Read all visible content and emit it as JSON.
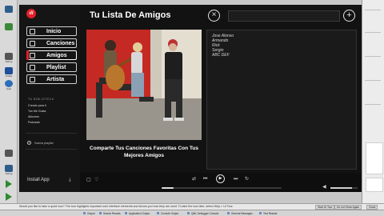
{
  "app": {
    "logo_text": "ıll",
    "nav": [
      {
        "label": "Inicio",
        "icon": "home-icon"
      },
      {
        "label": "Canciones",
        "icon": "music-note-icon"
      },
      {
        "label": "Amigos",
        "icon": "friends-icon"
      },
      {
        "label": "Playlist",
        "icon": "playlist-icon"
      },
      {
        "label": "Artista",
        "icon": "artist-icon"
      }
    ],
    "active_nav": "Amigos",
    "library": {
      "title": "TU BIBLIOTECA",
      "items": [
        "Creado para ti",
        "Tus Me Gusta",
        "Albumes",
        "Podcasts"
      ]
    },
    "new_playlist_label": "Nueva playlist",
    "install_label": "Install App",
    "main": {
      "title": "Tu Lista De Amigos",
      "caption": "Comparte Tus Canciones Favoritas Con Tus Mejores Amigos",
      "friends": [
        "Jose Alonso",
        "Armando",
        "Rick",
        "Sergio",
        "ABC DEF"
      ]
    },
    "player": {
      "progress": 0.1,
      "volume": 0.8
    }
  },
  "ide": {
    "rail": [
      {
        "label": "",
        "icon": "file-icon",
        "color": "#2f5d8a"
      },
      {
        "label": "",
        "icon": "edit-icon",
        "color": "#3b8a3b"
      },
      {
        "label": "Debug",
        "icon": "debug-icon",
        "color": "#555555"
      },
      {
        "label": "Profile",
        "icon": "profile-icon",
        "color": "#1f4e9a"
      },
      {
        "label": "Help",
        "icon": "help-icon",
        "color": "#2c6fb7"
      },
      {
        "label": "",
        "icon": "wrench-icon",
        "color": "#555555"
      },
      {
        "label": "Debug",
        "icon": "monitor-icon",
        "color": "#2f5d8a"
      },
      {
        "label": "",
        "icon": "run-icon",
        "color": "#2e8b2e"
      },
      {
        "label": "",
        "icon": "debug-run-icon",
        "color": "#2e8b2e"
      }
    ],
    "status_message": "Would you like to take a quick tour? The tour highlights important user interface elements and shows you how they are used. To take the tour later, select Help > UI Tour.",
    "status_buttons": [
      "Start UI Tour",
      "Do not Show Again",
      "Close"
    ],
    "tasks": [
      "Output",
      "Search Results",
      "Application Output",
      "Console Output",
      "QML Debugger Console",
      "General Messages",
      "Test Results"
    ]
  }
}
